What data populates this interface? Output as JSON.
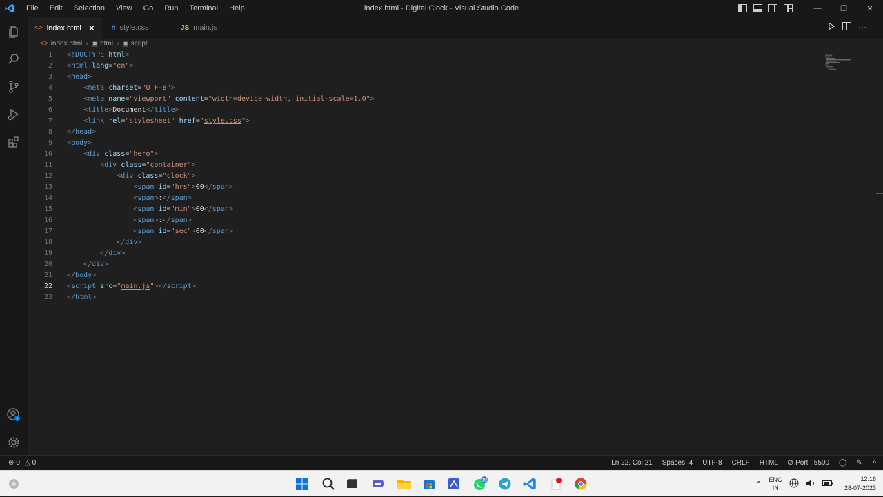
{
  "window": {
    "title": "index.html - Digital Clock - Visual Studio Code"
  },
  "menu": [
    "File",
    "Edit",
    "Selection",
    "View",
    "Go",
    "Run",
    "Terminal",
    "Help"
  ],
  "tabs": [
    {
      "label": "index.html",
      "icon": "<>",
      "active": true
    },
    {
      "label": "style.css",
      "icon": "#",
      "active": false
    },
    {
      "label": "main.js",
      "icon": "JS",
      "active": false
    }
  ],
  "breadcrumb": [
    "index.html",
    "html",
    "script"
  ],
  "code": {
    "line_numbers": [
      "1",
      "2",
      "3",
      "4",
      "5",
      "6",
      "7",
      "8",
      "9",
      "10",
      "11",
      "12",
      "13",
      "14",
      "15",
      "16",
      "17",
      "18",
      "19",
      "20",
      "21",
      "22",
      "23"
    ],
    "current_line": "22"
  },
  "statusbar": {
    "errors": "0",
    "warnings": "0",
    "position": "Ln 22, Col 21",
    "spaces": "Spaces: 4",
    "encoding": "UTF-8",
    "eol": "CRLF",
    "language": "HTML",
    "port": "Port : 5500"
  },
  "activity_badge": "1",
  "taskbar": {
    "whatsapp_badge": "19",
    "lang_top": "ENG",
    "lang_bottom": "IN",
    "time": "12:16",
    "date": "28-07-2023"
  },
  "colors": {
    "accent": "#0078d4",
    "editor_bg": "#1f1f1f",
    "tag": "#569cd6",
    "attr": "#9cdcfe",
    "string": "#ce9178"
  }
}
